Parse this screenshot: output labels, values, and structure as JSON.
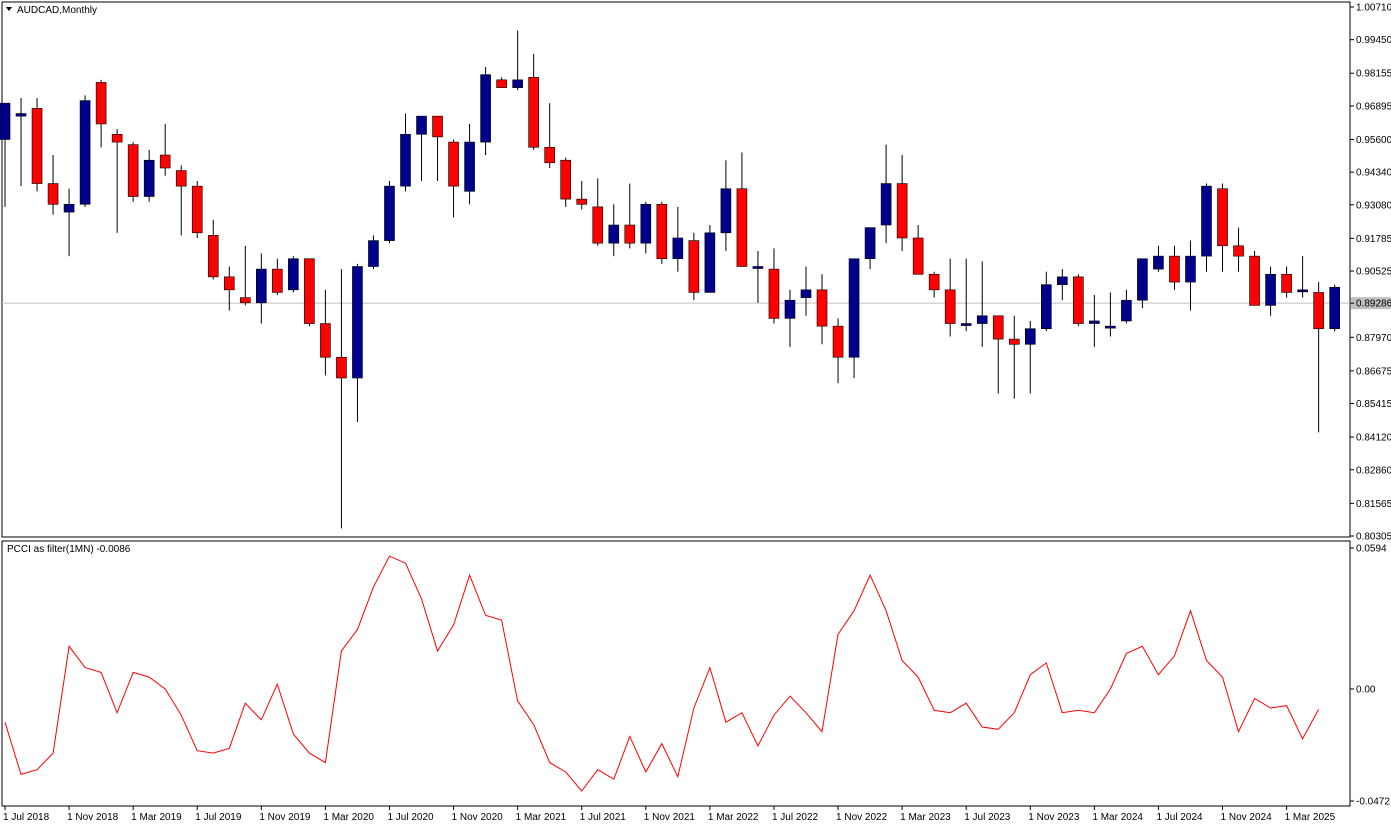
{
  "colors": {
    "bull": "#00008b",
    "bear": "#ff0000",
    "wick": "#000000",
    "background": "#ffffff",
    "axis": "#000000",
    "current_price_line": "#c0c0c0",
    "indicator_line": "#ff0000"
  },
  "chart_data": [
    {
      "type": "candlestick",
      "title": "AUDCAD,Monthly",
      "current_price": 0.89286,
      "current_price_label": "0.89286",
      "ylim": [
        0.80305,
        1.0071
      ],
      "y_tick_labels": [
        "1.00710",
        "0.99450",
        "0.98155",
        "0.96895",
        "0.95600",
        "0.94340",
        "0.93080",
        "0.91785",
        "0.90525",
        "0.89286",
        "0.87970",
        "0.86675",
        "0.85415",
        "0.84120",
        "0.82860",
        "0.81565",
        "0.80305"
      ],
      "grid": false,
      "candles": [
        {
          "o": 0.956,
          "h": 0.956,
          "l": 0.93,
          "c": 0.97
        },
        {
          "o": 0.965,
          "h": 0.972,
          "l": 0.938,
          "c": 0.966
        },
        {
          "o": 0.968,
          "h": 0.972,
          "l": 0.936,
          "c": 0.939
        },
        {
          "o": 0.939,
          "h": 0.95,
          "l": 0.927,
          "c": 0.931
        },
        {
          "o": 0.928,
          "h": 0.937,
          "l": 0.911,
          "c": 0.931
        },
        {
          "o": 0.931,
          "h": 0.973,
          "l": 0.93,
          "c": 0.971
        },
        {
          "o": 0.978,
          "h": 0.979,
          "l": 0.953,
          "c": 0.962
        },
        {
          "o": 0.958,
          "h": 0.96,
          "l": 0.92,
          "c": 0.955
        },
        {
          "o": 0.954,
          "h": 0.955,
          "l": 0.932,
          "c": 0.934
        },
        {
          "o": 0.934,
          "h": 0.952,
          "l": 0.932,
          "c": 0.948
        },
        {
          "o": 0.95,
          "h": 0.962,
          "l": 0.942,
          "c": 0.945
        },
        {
          "o": 0.944,
          "h": 0.946,
          "l": 0.919,
          "c": 0.938
        },
        {
          "o": 0.938,
          "h": 0.94,
          "l": 0.918,
          "c": 0.92
        },
        {
          "o": 0.919,
          "h": 0.925,
          "l": 0.902,
          "c": 0.903
        },
        {
          "o": 0.903,
          "h": 0.907,
          "l": 0.89,
          "c": 0.898
        },
        {
          "o": 0.895,
          "h": 0.915,
          "l": 0.892,
          "c": 0.893
        },
        {
          "o": 0.893,
          "h": 0.912,
          "l": 0.885,
          "c": 0.906
        },
        {
          "o": 0.906,
          "h": 0.91,
          "l": 0.896,
          "c": 0.897
        },
        {
          "o": 0.898,
          "h": 0.911,
          "l": 0.897,
          "c": 0.91
        },
        {
          "o": 0.91,
          "h": 0.91,
          "l": 0.884,
          "c": 0.885
        },
        {
          "o": 0.885,
          "h": 0.898,
          "l": 0.865,
          "c": 0.872
        },
        {
          "o": 0.872,
          "h": 0.906,
          "l": 0.806,
          "c": 0.864
        },
        {
          "o": 0.864,
          "h": 0.908,
          "l": 0.847,
          "c": 0.907
        },
        {
          "o": 0.907,
          "h": 0.919,
          "l": 0.906,
          "c": 0.917
        },
        {
          "o": 0.917,
          "h": 0.94,
          "l": 0.916,
          "c": 0.938
        },
        {
          "o": 0.938,
          "h": 0.966,
          "l": 0.936,
          "c": 0.958
        },
        {
          "o": 0.958,
          "h": 0.962,
          "l": 0.94,
          "c": 0.965
        },
        {
          "o": 0.965,
          "h": 0.965,
          "l": 0.94,
          "c": 0.957
        },
        {
          "o": 0.955,
          "h": 0.956,
          "l": 0.926,
          "c": 0.938
        },
        {
          "o": 0.936,
          "h": 0.962,
          "l": 0.931,
          "c": 0.955
        },
        {
          "o": 0.955,
          "h": 0.984,
          "l": 0.95,
          "c": 0.981
        },
        {
          "o": 0.979,
          "h": 0.98,
          "l": 0.977,
          "c": 0.976
        },
        {
          "o": 0.976,
          "h": 0.998,
          "l": 0.975,
          "c": 0.979
        },
        {
          "o": 0.98,
          "h": 0.989,
          "l": 0.952,
          "c": 0.953
        },
        {
          "o": 0.953,
          "h": 0.97,
          "l": 0.945,
          "c": 0.947
        },
        {
          "o": 0.948,
          "h": 0.949,
          "l": 0.93,
          "c": 0.933
        },
        {
          "o": 0.933,
          "h": 0.94,
          "l": 0.929,
          "c": 0.931
        },
        {
          "o": 0.93,
          "h": 0.941,
          "l": 0.915,
          "c": 0.916
        },
        {
          "o": 0.916,
          "h": 0.931,
          "l": 0.911,
          "c": 0.923
        },
        {
          "o": 0.923,
          "h": 0.939,
          "l": 0.914,
          "c": 0.916
        },
        {
          "o": 0.916,
          "h": 0.932,
          "l": 0.912,
          "c": 0.931
        },
        {
          "o": 0.931,
          "h": 0.932,
          "l": 0.908,
          "c": 0.91
        },
        {
          "o": 0.91,
          "h": 0.93,
          "l": 0.905,
          "c": 0.918
        },
        {
          "o": 0.917,
          "h": 0.92,
          "l": 0.894,
          "c": 0.897
        },
        {
          "o": 0.897,
          "h": 0.923,
          "l": 0.897,
          "c": 0.92
        },
        {
          "o": 0.92,
          "h": 0.948,
          "l": 0.913,
          "c": 0.937
        },
        {
          "o": 0.937,
          "h": 0.951,
          "l": 0.908,
          "c": 0.907
        },
        {
          "o": 0.907,
          "h": 0.913,
          "l": 0.893,
          "c": 0.907
        },
        {
          "o": 0.906,
          "h": 0.914,
          "l": 0.885,
          "c": 0.887
        },
        {
          "o": 0.887,
          "h": 0.898,
          "l": 0.876,
          "c": 0.894
        },
        {
          "o": 0.895,
          "h": 0.907,
          "l": 0.888,
          "c": 0.898
        },
        {
          "o": 0.898,
          "h": 0.904,
          "l": 0.877,
          "c": 0.884
        },
        {
          "o": 0.884,
          "h": 0.887,
          "l": 0.862,
          "c": 0.872
        },
        {
          "o": 0.872,
          "h": 0.904,
          "l": 0.864,
          "c": 0.91
        },
        {
          "o": 0.91,
          "h": 0.921,
          "l": 0.906,
          "c": 0.922
        },
        {
          "o": 0.923,
          "h": 0.954,
          "l": 0.916,
          "c": 0.939
        },
        {
          "o": 0.939,
          "h": 0.95,
          "l": 0.913,
          "c": 0.918
        },
        {
          "o": 0.918,
          "h": 0.923,
          "l": 0.908,
          "c": 0.904
        },
        {
          "o": 0.904,
          "h": 0.905,
          "l": 0.895,
          "c": 0.898
        },
        {
          "o": 0.898,
          "h": 0.91,
          "l": 0.88,
          "c": 0.885
        },
        {
          "o": 0.885,
          "h": 0.91,
          "l": 0.882,
          "c": 0.885
        },
        {
          "o": 0.885,
          "h": 0.909,
          "l": 0.876,
          "c": 0.888
        },
        {
          "o": 0.888,
          "h": 0.888,
          "l": 0.858,
          "c": 0.879
        },
        {
          "o": 0.879,
          "h": 0.888,
          "l": 0.856,
          "c": 0.877
        },
        {
          "o": 0.877,
          "h": 0.886,
          "l": 0.858,
          "c": 0.883
        },
        {
          "o": 0.883,
          "h": 0.905,
          "l": 0.882,
          "c": 0.9
        },
        {
          "o": 0.9,
          "h": 0.906,
          "l": 0.894,
          "c": 0.903
        },
        {
          "o": 0.903,
          "h": 0.904,
          "l": 0.884,
          "c": 0.885
        },
        {
          "o": 0.885,
          "h": 0.896,
          "l": 0.876,
          "c": 0.886
        },
        {
          "o": 0.884,
          "h": 0.897,
          "l": 0.88,
          "c": 0.884
        },
        {
          "o": 0.886,
          "h": 0.898,
          "l": 0.885,
          "c": 0.894
        },
        {
          "o": 0.894,
          "h": 0.908,
          "l": 0.891,
          "c": 0.91
        },
        {
          "o": 0.906,
          "h": 0.915,
          "l": 0.905,
          "c": 0.911
        },
        {
          "o": 0.911,
          "h": 0.915,
          "l": 0.898,
          "c": 0.901
        },
        {
          "o": 0.901,
          "h": 0.917,
          "l": 0.89,
          "c": 0.911
        },
        {
          "o": 0.911,
          "h": 0.939,
          "l": 0.905,
          "c": 0.938
        },
        {
          "o": 0.937,
          "h": 0.939,
          "l": 0.905,
          "c": 0.915
        },
        {
          "o": 0.915,
          "h": 0.922,
          "l": 0.905,
          "c": 0.911
        },
        {
          "o": 0.911,
          "h": 0.913,
          "l": 0.892,
          "c": 0.892
        },
        {
          "o": 0.892,
          "h": 0.907,
          "l": 0.888,
          "c": 0.904
        },
        {
          "o": 0.904,
          "h": 0.907,
          "l": 0.895,
          "c": 0.897
        },
        {
          "o": 0.898,
          "h": 0.911,
          "l": 0.895,
          "c": 0.898
        },
        {
          "o": 0.897,
          "h": 0.901,
          "l": 0.843,
          "c": 0.883
        },
        {
          "o": 0.883,
          "h": 0.9,
          "l": 0.882,
          "c": 0.899
        }
      ],
      "x_tick_labels": [
        "1 Jul 2018",
        "1 Nov 2018",
        "1 Mar 2019",
        "1 Jul 2019",
        "1 Nov 2019",
        "1 Mar 2020",
        "1 Jul 2020",
        "1 Nov 2020",
        "1 Mar 2021",
        "1 Jul 2021",
        "1 Nov 2021",
        "1 Mar 2022",
        "1 Jul 2022",
        "1 Nov 2022",
        "1 Mar 2023",
        "1 Jul 2023",
        "1 Nov 2023",
        "1 Mar 2024",
        "1 Jul 2024",
        "1 Nov 2024",
        "1 Mar 2025"
      ]
    },
    {
      "type": "line",
      "title": "PCCI as filter(1MN) -0.0086",
      "ylim": [
        -0.0472,
        0.0594
      ],
      "y_tick_labels": [
        "0.0594",
        "0.00",
        "-0.0472"
      ],
      "grid": false,
      "series": [
        {
          "values": [
            -0.014,
            -0.036,
            -0.034,
            -0.027,
            0.018,
            0.009,
            0.007,
            -0.01,
            0.007,
            0.005,
            0.0,
            -0.011,
            -0.026,
            -0.027,
            -0.025,
            -0.006,
            -0.013,
            0.002,
            -0.019,
            -0.027,
            -0.031,
            0.016,
            0.025,
            0.043,
            0.056,
            0.053,
            0.038,
            0.016,
            0.027,
            0.048,
            0.031,
            0.029,
            -0.005,
            -0.015,
            -0.031,
            -0.035,
            -0.043,
            -0.034,
            -0.038,
            -0.02,
            -0.035,
            -0.023,
            -0.037,
            -0.008,
            0.009,
            -0.014,
            -0.01,
            -0.024,
            -0.011,
            -0.003,
            -0.01,
            -0.018,
            0.023,
            0.033,
            0.048,
            0.033,
            0.012,
            0.005,
            -0.009,
            -0.01,
            -0.006,
            -0.016,
            -0.017,
            -0.01,
            0.006,
            0.011,
            -0.01,
            -0.009,
            -0.01,
            0.0,
            0.015,
            0.018,
            0.006,
            0.014,
            0.033,
            0.012,
            0.005,
            -0.018,
            -0.004,
            -0.008,
            -0.007,
            -0.021,
            -0.0086
          ]
        }
      ]
    }
  ]
}
